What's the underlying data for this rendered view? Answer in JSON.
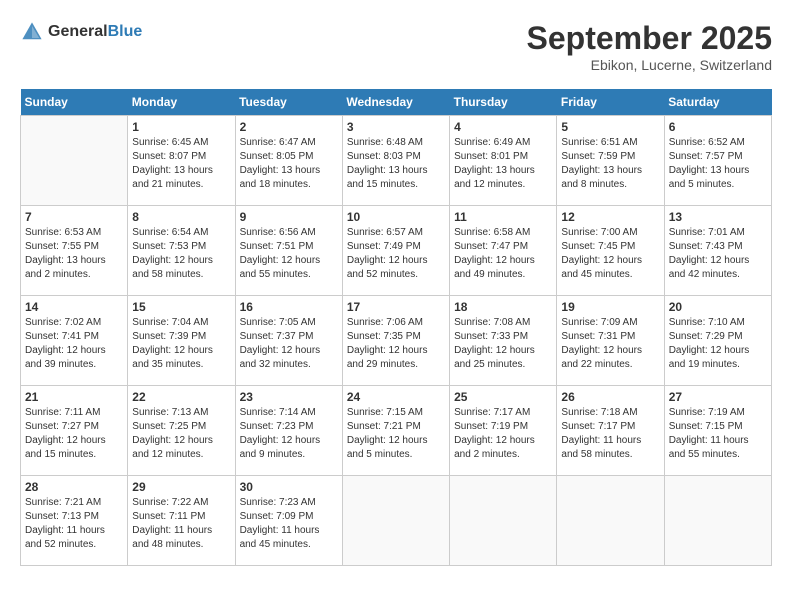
{
  "header": {
    "logo_general": "General",
    "logo_blue": "Blue",
    "month_title": "September 2025",
    "location": "Ebikon, Lucerne, Switzerland"
  },
  "weekdays": [
    "Sunday",
    "Monday",
    "Tuesday",
    "Wednesday",
    "Thursday",
    "Friday",
    "Saturday"
  ],
  "weeks": [
    [
      {
        "day": "",
        "info": ""
      },
      {
        "day": "1",
        "info": "Sunrise: 6:45 AM\nSunset: 8:07 PM\nDaylight: 13 hours\nand 21 minutes."
      },
      {
        "day": "2",
        "info": "Sunrise: 6:47 AM\nSunset: 8:05 PM\nDaylight: 13 hours\nand 18 minutes."
      },
      {
        "day": "3",
        "info": "Sunrise: 6:48 AM\nSunset: 8:03 PM\nDaylight: 13 hours\nand 15 minutes."
      },
      {
        "day": "4",
        "info": "Sunrise: 6:49 AM\nSunset: 8:01 PM\nDaylight: 13 hours\nand 12 minutes."
      },
      {
        "day": "5",
        "info": "Sunrise: 6:51 AM\nSunset: 7:59 PM\nDaylight: 13 hours\nand 8 minutes."
      },
      {
        "day": "6",
        "info": "Sunrise: 6:52 AM\nSunset: 7:57 PM\nDaylight: 13 hours\nand 5 minutes."
      }
    ],
    [
      {
        "day": "7",
        "info": "Sunrise: 6:53 AM\nSunset: 7:55 PM\nDaylight: 13 hours\nand 2 minutes."
      },
      {
        "day": "8",
        "info": "Sunrise: 6:54 AM\nSunset: 7:53 PM\nDaylight: 12 hours\nand 58 minutes."
      },
      {
        "day": "9",
        "info": "Sunrise: 6:56 AM\nSunset: 7:51 PM\nDaylight: 12 hours\nand 55 minutes."
      },
      {
        "day": "10",
        "info": "Sunrise: 6:57 AM\nSunset: 7:49 PM\nDaylight: 12 hours\nand 52 minutes."
      },
      {
        "day": "11",
        "info": "Sunrise: 6:58 AM\nSunset: 7:47 PM\nDaylight: 12 hours\nand 49 minutes."
      },
      {
        "day": "12",
        "info": "Sunrise: 7:00 AM\nSunset: 7:45 PM\nDaylight: 12 hours\nand 45 minutes."
      },
      {
        "day": "13",
        "info": "Sunrise: 7:01 AM\nSunset: 7:43 PM\nDaylight: 12 hours\nand 42 minutes."
      }
    ],
    [
      {
        "day": "14",
        "info": "Sunrise: 7:02 AM\nSunset: 7:41 PM\nDaylight: 12 hours\nand 39 minutes."
      },
      {
        "day": "15",
        "info": "Sunrise: 7:04 AM\nSunset: 7:39 PM\nDaylight: 12 hours\nand 35 minutes."
      },
      {
        "day": "16",
        "info": "Sunrise: 7:05 AM\nSunset: 7:37 PM\nDaylight: 12 hours\nand 32 minutes."
      },
      {
        "day": "17",
        "info": "Sunrise: 7:06 AM\nSunset: 7:35 PM\nDaylight: 12 hours\nand 29 minutes."
      },
      {
        "day": "18",
        "info": "Sunrise: 7:08 AM\nSunset: 7:33 PM\nDaylight: 12 hours\nand 25 minutes."
      },
      {
        "day": "19",
        "info": "Sunrise: 7:09 AM\nSunset: 7:31 PM\nDaylight: 12 hours\nand 22 minutes."
      },
      {
        "day": "20",
        "info": "Sunrise: 7:10 AM\nSunset: 7:29 PM\nDaylight: 12 hours\nand 19 minutes."
      }
    ],
    [
      {
        "day": "21",
        "info": "Sunrise: 7:11 AM\nSunset: 7:27 PM\nDaylight: 12 hours\nand 15 minutes."
      },
      {
        "day": "22",
        "info": "Sunrise: 7:13 AM\nSunset: 7:25 PM\nDaylight: 12 hours\nand 12 minutes."
      },
      {
        "day": "23",
        "info": "Sunrise: 7:14 AM\nSunset: 7:23 PM\nDaylight: 12 hours\nand 9 minutes."
      },
      {
        "day": "24",
        "info": "Sunrise: 7:15 AM\nSunset: 7:21 PM\nDaylight: 12 hours\nand 5 minutes."
      },
      {
        "day": "25",
        "info": "Sunrise: 7:17 AM\nSunset: 7:19 PM\nDaylight: 12 hours\nand 2 minutes."
      },
      {
        "day": "26",
        "info": "Sunrise: 7:18 AM\nSunset: 7:17 PM\nDaylight: 11 hours\nand 58 minutes."
      },
      {
        "day": "27",
        "info": "Sunrise: 7:19 AM\nSunset: 7:15 PM\nDaylight: 11 hours\nand 55 minutes."
      }
    ],
    [
      {
        "day": "28",
        "info": "Sunrise: 7:21 AM\nSunset: 7:13 PM\nDaylight: 11 hours\nand 52 minutes."
      },
      {
        "day": "29",
        "info": "Sunrise: 7:22 AM\nSunset: 7:11 PM\nDaylight: 11 hours\nand 48 minutes."
      },
      {
        "day": "30",
        "info": "Sunrise: 7:23 AM\nSunset: 7:09 PM\nDaylight: 11 hours\nand 45 minutes."
      },
      {
        "day": "",
        "info": ""
      },
      {
        "day": "",
        "info": ""
      },
      {
        "day": "",
        "info": ""
      },
      {
        "day": "",
        "info": ""
      }
    ]
  ]
}
